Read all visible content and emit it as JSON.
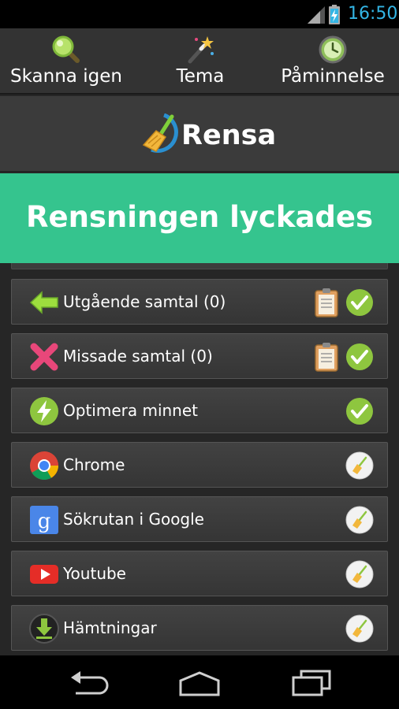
{
  "status_bar": {
    "time": "16:50",
    "icons": [
      "signal-icon",
      "battery-charging-icon"
    ],
    "time_color": "#33b5e5"
  },
  "action_bar": {
    "actions": [
      {
        "label": "Skanna igen",
        "icon": "magnifier-icon"
      },
      {
        "label": "Tema",
        "icon": "magic-wand-icon"
      },
      {
        "label": "Påminnelse",
        "icon": "clock-icon"
      }
    ]
  },
  "header": {
    "app_title": "Rensa",
    "logo_icon": "broom-logo-icon"
  },
  "banner": {
    "message": "Rensningen lyckades",
    "color": "#35c48e"
  },
  "list": {
    "items": [
      {
        "label": "Utgående samtal (0)",
        "icon": "outgoing-arrow-icon",
        "has_clipboard": true,
        "status": "done"
      },
      {
        "label": "Missade samtal (0)",
        "icon": "missed-call-x-icon",
        "has_clipboard": true,
        "status": "done"
      },
      {
        "label": "Optimera minnet",
        "icon": "lightning-icon",
        "has_clipboard": false,
        "status": "done"
      },
      {
        "label": "Chrome",
        "icon": "chrome-icon",
        "has_clipboard": false,
        "status": "clean"
      },
      {
        "label": "Sökrutan i Google",
        "icon": "google-search-icon",
        "has_clipboard": false,
        "status": "clean"
      },
      {
        "label": "Youtube",
        "icon": "youtube-icon",
        "has_clipboard": false,
        "status": "clean"
      },
      {
        "label": "Hämtningar",
        "icon": "download-icon",
        "has_clipboard": false,
        "status": "clean"
      }
    ]
  },
  "nav_bar": {
    "buttons": [
      "back-icon",
      "home-icon",
      "recent-apps-icon"
    ]
  }
}
